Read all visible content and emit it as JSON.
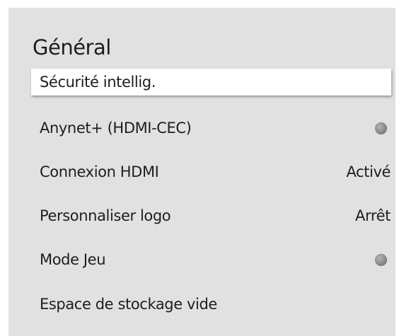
{
  "menu": {
    "title": "Général",
    "items": [
      {
        "label": "Sécurité intellig.",
        "value": "",
        "selected": true
      },
      {
        "label": "Anynet+ (HDMI-CEC)",
        "value": "",
        "toggle": "toggle-off-icon"
      },
      {
        "label": "Connexion HDMI",
        "value": "Activé"
      },
      {
        "label": "Personnaliser logo",
        "value": "Arrêt"
      },
      {
        "label": "Mode Jeu",
        "value": "",
        "toggle": "toggle-off-icon"
      },
      {
        "label": "Espace de stockage vide",
        "value": ""
      }
    ]
  }
}
